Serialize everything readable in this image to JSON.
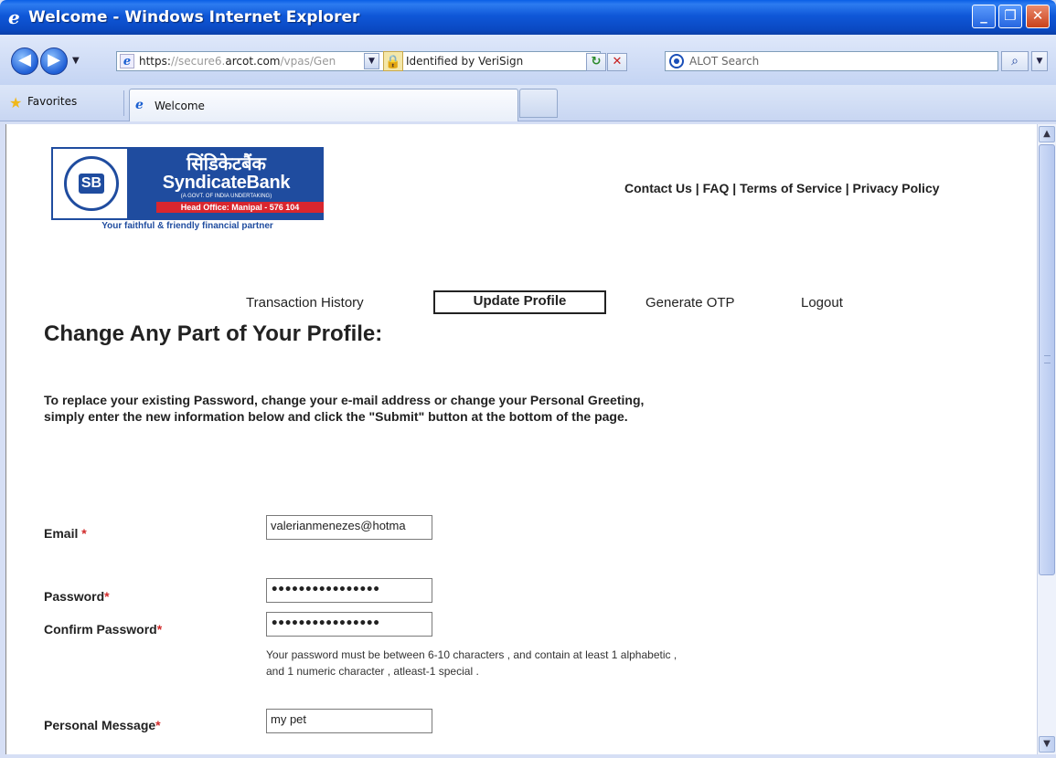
{
  "window": {
    "title": "Welcome - Windows Internet Explorer",
    "minimize": "_",
    "maximize": "❐",
    "close": "✕"
  },
  "browser": {
    "url_secure": "https:",
    "url_faded": "//secure6.",
    "url_host": "arcot.com",
    "url_path": "/vpas/Gen",
    "identity": "Identified by VeriSign",
    "search_placeholder": "ALOT Search",
    "favorites": "Favorites",
    "tab_title": "Welcome"
  },
  "bank": {
    "hindi_name": "सिंडिकेटबैंक",
    "name": "SyndicateBank",
    "govt": "(A GOVT. OF INDIA UNDERTAKING)",
    "head_office": "Head Office: Manipal - 576 104",
    "tagline": "Your faithful & friendly financial partner",
    "emblem_text": "SB"
  },
  "toplinks": "Contact Us | FAQ | Terms of Service | Privacy Policy",
  "nav": {
    "history": "Transaction History",
    "update": "Update Profile",
    "otp": "Generate OTP",
    "logout": "Logout"
  },
  "heading": "Change Any Part of Your Profile:",
  "intro": "To replace your existing Password, change your e-mail address or change your Personal Greeting, simply enter the new information below and click the \"Submit\" button at the bottom of the page.",
  "form": {
    "email_label": "Email ",
    "email_value": "valerianmenezes@hotma",
    "password_label": "Password",
    "password_value": "••••••••••••••••",
    "confirm_label": "Confirm Password",
    "confirm_value": "••••••••••••••••",
    "hint": "Your password must be between 6-10 characters , and contain at least 1 alphabetic , and 1 numeric character , atleast-1 special .",
    "message_label": "Personal Message",
    "message_value": "my pet",
    "required_mark": "*"
  }
}
